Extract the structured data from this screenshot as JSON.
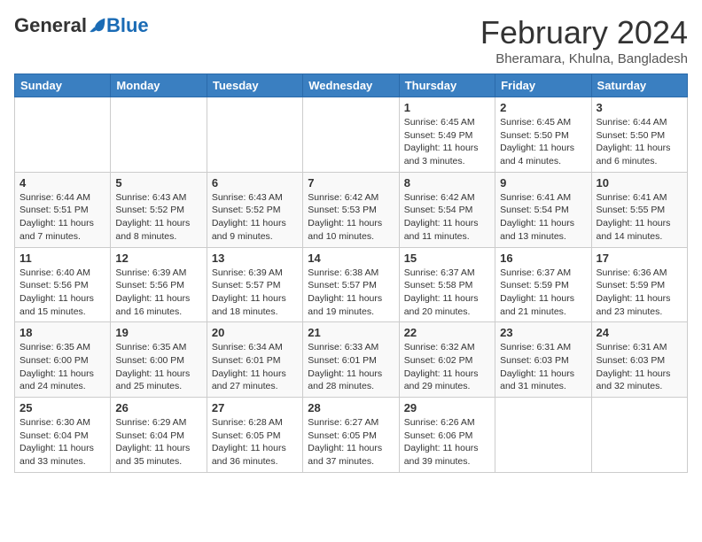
{
  "logo": {
    "general": "General",
    "blue": "Blue"
  },
  "header": {
    "title": "February 2024",
    "subtitle": "Bheramara, Khulna, Bangladesh"
  },
  "days_of_week": [
    "Sunday",
    "Monday",
    "Tuesday",
    "Wednesday",
    "Thursday",
    "Friday",
    "Saturday"
  ],
  "weeks": [
    [
      {
        "day": "",
        "info": ""
      },
      {
        "day": "",
        "info": ""
      },
      {
        "day": "",
        "info": ""
      },
      {
        "day": "",
        "info": ""
      },
      {
        "day": "1",
        "info": "Sunrise: 6:45 AM\nSunset: 5:49 PM\nDaylight: 11 hours and 3 minutes."
      },
      {
        "day": "2",
        "info": "Sunrise: 6:45 AM\nSunset: 5:50 PM\nDaylight: 11 hours and 4 minutes."
      },
      {
        "day": "3",
        "info": "Sunrise: 6:44 AM\nSunset: 5:50 PM\nDaylight: 11 hours and 6 minutes."
      }
    ],
    [
      {
        "day": "4",
        "info": "Sunrise: 6:44 AM\nSunset: 5:51 PM\nDaylight: 11 hours and 7 minutes."
      },
      {
        "day": "5",
        "info": "Sunrise: 6:43 AM\nSunset: 5:52 PM\nDaylight: 11 hours and 8 minutes."
      },
      {
        "day": "6",
        "info": "Sunrise: 6:43 AM\nSunset: 5:52 PM\nDaylight: 11 hours and 9 minutes."
      },
      {
        "day": "7",
        "info": "Sunrise: 6:42 AM\nSunset: 5:53 PM\nDaylight: 11 hours and 10 minutes."
      },
      {
        "day": "8",
        "info": "Sunrise: 6:42 AM\nSunset: 5:54 PM\nDaylight: 11 hours and 11 minutes."
      },
      {
        "day": "9",
        "info": "Sunrise: 6:41 AM\nSunset: 5:54 PM\nDaylight: 11 hours and 13 minutes."
      },
      {
        "day": "10",
        "info": "Sunrise: 6:41 AM\nSunset: 5:55 PM\nDaylight: 11 hours and 14 minutes."
      }
    ],
    [
      {
        "day": "11",
        "info": "Sunrise: 6:40 AM\nSunset: 5:56 PM\nDaylight: 11 hours and 15 minutes."
      },
      {
        "day": "12",
        "info": "Sunrise: 6:39 AM\nSunset: 5:56 PM\nDaylight: 11 hours and 16 minutes."
      },
      {
        "day": "13",
        "info": "Sunrise: 6:39 AM\nSunset: 5:57 PM\nDaylight: 11 hours and 18 minutes."
      },
      {
        "day": "14",
        "info": "Sunrise: 6:38 AM\nSunset: 5:57 PM\nDaylight: 11 hours and 19 minutes."
      },
      {
        "day": "15",
        "info": "Sunrise: 6:37 AM\nSunset: 5:58 PM\nDaylight: 11 hours and 20 minutes."
      },
      {
        "day": "16",
        "info": "Sunrise: 6:37 AM\nSunset: 5:59 PM\nDaylight: 11 hours and 21 minutes."
      },
      {
        "day": "17",
        "info": "Sunrise: 6:36 AM\nSunset: 5:59 PM\nDaylight: 11 hours and 23 minutes."
      }
    ],
    [
      {
        "day": "18",
        "info": "Sunrise: 6:35 AM\nSunset: 6:00 PM\nDaylight: 11 hours and 24 minutes."
      },
      {
        "day": "19",
        "info": "Sunrise: 6:35 AM\nSunset: 6:00 PM\nDaylight: 11 hours and 25 minutes."
      },
      {
        "day": "20",
        "info": "Sunrise: 6:34 AM\nSunset: 6:01 PM\nDaylight: 11 hours and 27 minutes."
      },
      {
        "day": "21",
        "info": "Sunrise: 6:33 AM\nSunset: 6:01 PM\nDaylight: 11 hours and 28 minutes."
      },
      {
        "day": "22",
        "info": "Sunrise: 6:32 AM\nSunset: 6:02 PM\nDaylight: 11 hours and 29 minutes."
      },
      {
        "day": "23",
        "info": "Sunrise: 6:31 AM\nSunset: 6:03 PM\nDaylight: 11 hours and 31 minutes."
      },
      {
        "day": "24",
        "info": "Sunrise: 6:31 AM\nSunset: 6:03 PM\nDaylight: 11 hours and 32 minutes."
      }
    ],
    [
      {
        "day": "25",
        "info": "Sunrise: 6:30 AM\nSunset: 6:04 PM\nDaylight: 11 hours and 33 minutes."
      },
      {
        "day": "26",
        "info": "Sunrise: 6:29 AM\nSunset: 6:04 PM\nDaylight: 11 hours and 35 minutes."
      },
      {
        "day": "27",
        "info": "Sunrise: 6:28 AM\nSunset: 6:05 PM\nDaylight: 11 hours and 36 minutes."
      },
      {
        "day": "28",
        "info": "Sunrise: 6:27 AM\nSunset: 6:05 PM\nDaylight: 11 hours and 37 minutes."
      },
      {
        "day": "29",
        "info": "Sunrise: 6:26 AM\nSunset: 6:06 PM\nDaylight: 11 hours and 39 minutes."
      },
      {
        "day": "",
        "info": ""
      },
      {
        "day": "",
        "info": ""
      }
    ]
  ]
}
